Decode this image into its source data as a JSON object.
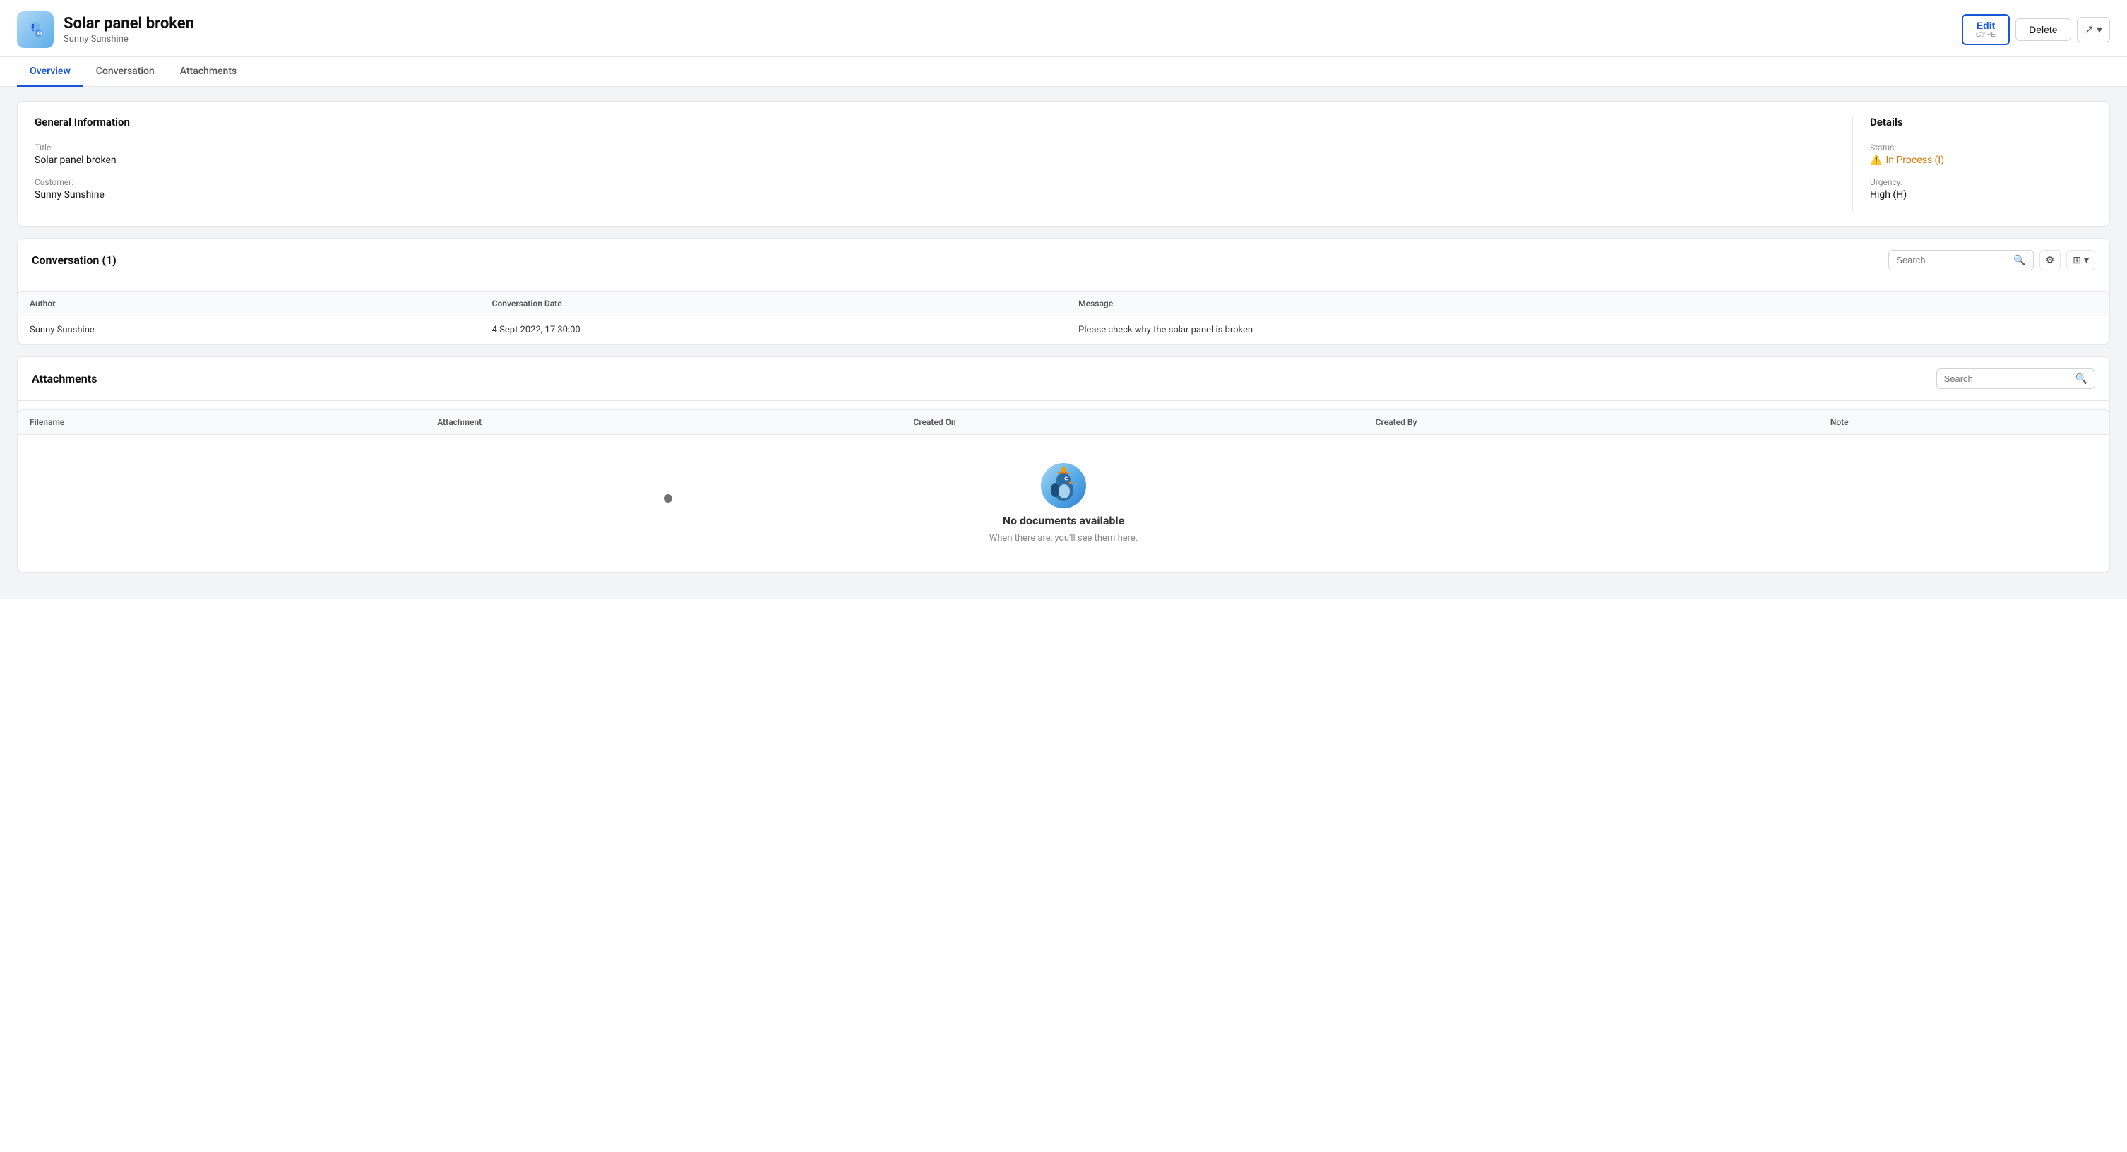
{
  "header": {
    "title": "Solar panel broken",
    "subtitle": "Sunny Sunshine",
    "edit_label": "Edit",
    "edit_shortcut": "Ctrl+E",
    "delete_label": "Delete"
  },
  "tabs": [
    {
      "id": "overview",
      "label": "Overview",
      "active": true
    },
    {
      "id": "conversation",
      "label": "Conversation",
      "active": false
    },
    {
      "id": "attachments",
      "label": "Attachments",
      "active": false
    }
  ],
  "general_information": {
    "section_title": "General Information",
    "title_label": "Title:",
    "title_value": "Solar panel broken",
    "customer_label": "Customer:",
    "customer_value": "Sunny Sunshine"
  },
  "details": {
    "section_title": "Details",
    "status_label": "Status:",
    "status_value": "In Process (I)",
    "urgency_label": "Urgency:",
    "urgency_value": "High (H)"
  },
  "conversation": {
    "section_title": "Conversation (1)",
    "search_placeholder": "Search",
    "table_headers": [
      "Author",
      "Conversation Date",
      "Message"
    ],
    "rows": [
      {
        "author": "Sunny Sunshine",
        "date": "4 Sept 2022, 17:30:00",
        "message": "Please check why the solar panel is broken"
      }
    ]
  },
  "attachments": {
    "section_title": "Attachments",
    "search_placeholder": "Search",
    "table_headers": [
      "Filename",
      "Attachment",
      "Created On",
      "Created By",
      "Note"
    ],
    "empty_title": "No documents available",
    "empty_subtitle": "When there are, you'll see them here."
  }
}
